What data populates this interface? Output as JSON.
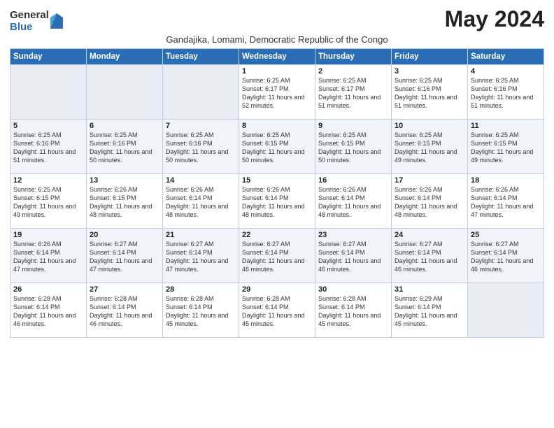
{
  "logo": {
    "general": "General",
    "blue": "Blue"
  },
  "title": "May 2024",
  "subtitle": "Gandajika, Lomami, Democratic Republic of the Congo",
  "days_of_week": [
    "Sunday",
    "Monday",
    "Tuesday",
    "Wednesday",
    "Thursday",
    "Friday",
    "Saturday"
  ],
  "weeks": [
    [
      {
        "day": "",
        "info": ""
      },
      {
        "day": "",
        "info": ""
      },
      {
        "day": "",
        "info": ""
      },
      {
        "day": "1",
        "info": "Sunrise: 6:25 AM\nSunset: 6:17 PM\nDaylight: 11 hours and 52 minutes."
      },
      {
        "day": "2",
        "info": "Sunrise: 6:25 AM\nSunset: 6:17 PM\nDaylight: 11 hours and 51 minutes."
      },
      {
        "day": "3",
        "info": "Sunrise: 6:25 AM\nSunset: 6:16 PM\nDaylight: 11 hours and 51 minutes."
      },
      {
        "day": "4",
        "info": "Sunrise: 6:25 AM\nSunset: 6:16 PM\nDaylight: 11 hours and 51 minutes."
      }
    ],
    [
      {
        "day": "5",
        "info": "Sunrise: 6:25 AM\nSunset: 6:16 PM\nDaylight: 11 hours and 51 minutes."
      },
      {
        "day": "6",
        "info": "Sunrise: 6:25 AM\nSunset: 6:16 PM\nDaylight: 11 hours and 50 minutes."
      },
      {
        "day": "7",
        "info": "Sunrise: 6:25 AM\nSunset: 6:16 PM\nDaylight: 11 hours and 50 minutes."
      },
      {
        "day": "8",
        "info": "Sunrise: 6:25 AM\nSunset: 6:15 PM\nDaylight: 11 hours and 50 minutes."
      },
      {
        "day": "9",
        "info": "Sunrise: 6:25 AM\nSunset: 6:15 PM\nDaylight: 11 hours and 50 minutes."
      },
      {
        "day": "10",
        "info": "Sunrise: 6:25 AM\nSunset: 6:15 PM\nDaylight: 11 hours and 49 minutes."
      },
      {
        "day": "11",
        "info": "Sunrise: 6:25 AM\nSunset: 6:15 PM\nDaylight: 11 hours and 49 minutes."
      }
    ],
    [
      {
        "day": "12",
        "info": "Sunrise: 6:25 AM\nSunset: 6:15 PM\nDaylight: 11 hours and 49 minutes."
      },
      {
        "day": "13",
        "info": "Sunrise: 6:26 AM\nSunset: 6:15 PM\nDaylight: 11 hours and 48 minutes."
      },
      {
        "day": "14",
        "info": "Sunrise: 6:26 AM\nSunset: 6:14 PM\nDaylight: 11 hours and 48 minutes."
      },
      {
        "day": "15",
        "info": "Sunrise: 6:26 AM\nSunset: 6:14 PM\nDaylight: 11 hours and 48 minutes."
      },
      {
        "day": "16",
        "info": "Sunrise: 6:26 AM\nSunset: 6:14 PM\nDaylight: 11 hours and 48 minutes."
      },
      {
        "day": "17",
        "info": "Sunrise: 6:26 AM\nSunset: 6:14 PM\nDaylight: 11 hours and 48 minutes."
      },
      {
        "day": "18",
        "info": "Sunrise: 6:26 AM\nSunset: 6:14 PM\nDaylight: 11 hours and 47 minutes."
      }
    ],
    [
      {
        "day": "19",
        "info": "Sunrise: 6:26 AM\nSunset: 6:14 PM\nDaylight: 11 hours and 47 minutes."
      },
      {
        "day": "20",
        "info": "Sunrise: 6:27 AM\nSunset: 6:14 PM\nDaylight: 11 hours and 47 minutes."
      },
      {
        "day": "21",
        "info": "Sunrise: 6:27 AM\nSunset: 6:14 PM\nDaylight: 11 hours and 47 minutes."
      },
      {
        "day": "22",
        "info": "Sunrise: 6:27 AM\nSunset: 6:14 PM\nDaylight: 11 hours and 46 minutes."
      },
      {
        "day": "23",
        "info": "Sunrise: 6:27 AM\nSunset: 6:14 PM\nDaylight: 11 hours and 46 minutes."
      },
      {
        "day": "24",
        "info": "Sunrise: 6:27 AM\nSunset: 6:14 PM\nDaylight: 11 hours and 46 minutes."
      },
      {
        "day": "25",
        "info": "Sunrise: 6:27 AM\nSunset: 6:14 PM\nDaylight: 11 hours and 46 minutes."
      }
    ],
    [
      {
        "day": "26",
        "info": "Sunrise: 6:28 AM\nSunset: 6:14 PM\nDaylight: 11 hours and 46 minutes."
      },
      {
        "day": "27",
        "info": "Sunrise: 6:28 AM\nSunset: 6:14 PM\nDaylight: 11 hours and 46 minutes."
      },
      {
        "day": "28",
        "info": "Sunrise: 6:28 AM\nSunset: 6:14 PM\nDaylight: 11 hours and 45 minutes."
      },
      {
        "day": "29",
        "info": "Sunrise: 6:28 AM\nSunset: 6:14 PM\nDaylight: 11 hours and 45 minutes."
      },
      {
        "day": "30",
        "info": "Sunrise: 6:28 AM\nSunset: 6:14 PM\nDaylight: 11 hours and 45 minutes."
      },
      {
        "day": "31",
        "info": "Sunrise: 6:29 AM\nSunset: 6:14 PM\nDaylight: 11 hours and 45 minutes."
      },
      {
        "day": "",
        "info": ""
      }
    ]
  ]
}
